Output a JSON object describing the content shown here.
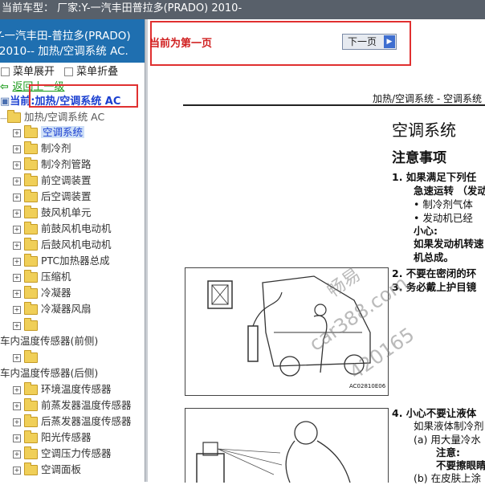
{
  "topbar": {
    "text": "当前车型：  厂家:Y-一汽丰田普拉多(PRADO) 2010-"
  },
  "left": {
    "header_line1": "Y-一汽丰田-普拉多(PRADO)",
    "header_line2": "-2010-- 加热/空调系统 AC.",
    "expand_label": "菜单展开",
    "collapse_label": "菜单折叠",
    "back_label": "返回上一级",
    "current_label": "当前:加热/空调系统 AC",
    "root_label": "加热/空调系统 AC",
    "items": [
      "空调系统",
      "制冷剂",
      "制冷剂管路",
      "前空调装置",
      "后空调装置",
      "鼓风机单元",
      "前鼓风机电动机",
      "后鼓风机电动机",
      "PTC加热器总成",
      "压缩机",
      "冷凝器",
      "冷凝器风扇"
    ],
    "bare1": "车内温度传感器(前侧)",
    "bare2": "车内温度传感器(后侧)",
    "items2": [
      "环境温度传感器",
      "前蒸发器温度传感器",
      "后蒸发器温度传感器",
      "阳光传感器",
      "空调压力传感器",
      "空调面板"
    ]
  },
  "right": {
    "first_page": "当前为第一页",
    "next_label": "下一页",
    "section_header": "加热/空调系统 - 空调系统",
    "title": "空调系统",
    "subtitle": "注意事项",
    "l1": "1.   如果满足下列任",
    "l2": "急速运转 （发动",
    "l3": "•  制冷剂气体",
    "l4": "•  发动机已经",
    "l5": "小心:",
    "l6": "如果发动机转速",
    "l7": "机总成。",
    "l8": "2.   不要在密闭的环",
    "l9": "3.   务必戴上护目镜",
    "img1_caption": "AC02810E06",
    "l10": "4.   小心不要让液体",
    "l11": "如果液体制冷剂",
    "l12": "(a)   用大量冷水",
    "l13": "注意:",
    "l14": "不要擦眼睛",
    "l15": "(b)   在皮肤上涂",
    "watermark1": "畅易",
    "watermark2": "car388.com",
    "watermark3": "420165"
  }
}
